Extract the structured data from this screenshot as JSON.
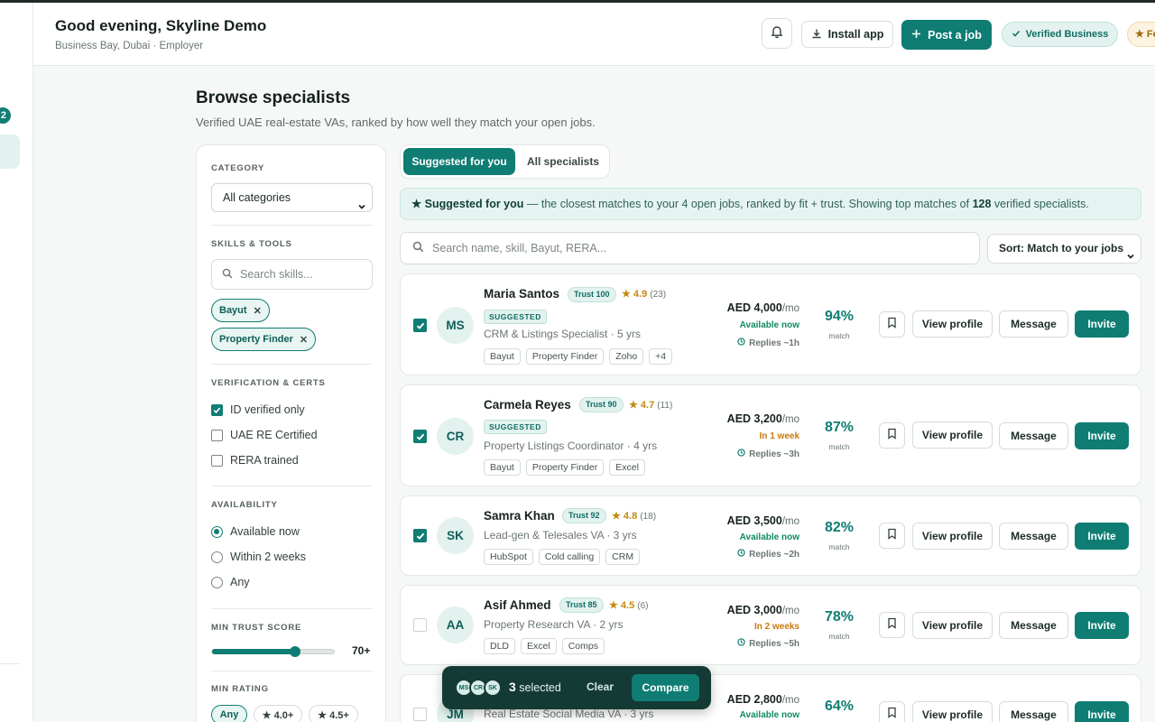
{
  "header": {
    "greeting": "Good evening, Skyline Demo",
    "location": "Business Bay, Dubai · Employer",
    "install_label": "Install app",
    "post_job_label": "Post a job",
    "verified_label": "Verified Business",
    "f_pill_label": "★ Fe"
  },
  "sidebar": {
    "badge": "2"
  },
  "page": {
    "title": "Browse specialists",
    "subtitle": "Verified UAE real-estate VAs, ranked by how well they match your open jobs."
  },
  "filters": {
    "category_label": "CATEGORY",
    "category_value": "All categories",
    "skills_label": "SKILLS & TOOLS",
    "skills_placeholder": "Search skills...",
    "chips": [
      "Bayut",
      "Property Finder"
    ],
    "verification_label": "VERIFICATION & CERTS",
    "verification": [
      {
        "label": "ID verified only",
        "checked": true
      },
      {
        "label": "UAE RE Certified",
        "checked": false
      },
      {
        "label": "RERA trained",
        "checked": false
      }
    ],
    "availability_label": "AVAILABILITY",
    "availability": [
      {
        "label": "Available now",
        "selected": true
      },
      {
        "label": "Within 2 weeks",
        "selected": false
      },
      {
        "label": "Any",
        "selected": false
      }
    ],
    "min_trust_label": "MIN TRUST SCORE",
    "min_trust_value": "70+",
    "min_trust_fraction": 0.68,
    "min_rating_label": "MIN RATING",
    "rating_options": [
      {
        "label": "Any",
        "selected": true
      },
      {
        "label": "★ 4.0+",
        "selected": false
      },
      {
        "label": "★ 4.5+",
        "selected": false
      }
    ]
  },
  "tabs": {
    "suggested": "Suggested for you",
    "all": "All specialists"
  },
  "banner": {
    "lead": "★ Suggested for you",
    "text_1": " — the closest matches to your 4 open jobs, ranked by fit + trust. Showing top matches of ",
    "count": "128",
    "text_2": " verified specialists."
  },
  "search": {
    "placeholder": "Search name, skill, Bayut, RERA..."
  },
  "sort": {
    "label": "Sort: Match to your jobs"
  },
  "actions": {
    "view_profile": "View profile",
    "message": "Message",
    "invite": "Invite",
    "match_label": "match",
    "per_month": "/mo"
  },
  "specialists": [
    {
      "initials": "MS",
      "name": "Maria Santos",
      "trust": "Trust 100",
      "rating": "★ 4.9",
      "reviews": "(23)",
      "suggested": "SUGGESTED",
      "role": "CRM & Listings Specialist · 5 yrs",
      "tags": [
        "Bayut",
        "Property Finder",
        "Zoho",
        "+4"
      ],
      "price": "AED 4,000",
      "availability": "Available now",
      "availability_color": "#0f8a5f",
      "replies": "Replies ~1h",
      "match": "94%",
      "checked": true
    },
    {
      "initials": "CR",
      "name": "Carmela Reyes",
      "trust": "Trust 90",
      "rating": "★ 4.7",
      "reviews": "(11)",
      "suggested": "SUGGESTED",
      "role": "Property Listings Coordinator · 4 yrs",
      "tags": [
        "Bayut",
        "Property Finder",
        "Excel"
      ],
      "price": "AED 3,200",
      "availability": "In 1 week",
      "availability_color": "#c77a0a",
      "replies": "Replies ~3h",
      "match": "87%",
      "checked": true
    },
    {
      "initials": "SK",
      "name": "Samra Khan",
      "trust": "Trust 92",
      "rating": "★ 4.8",
      "reviews": "(18)",
      "suggested": "",
      "role": "Lead-gen & Telesales VA · 3 yrs",
      "tags": [
        "HubSpot",
        "Cold calling",
        "CRM"
      ],
      "price": "AED 3,500",
      "availability": "Available now",
      "availability_color": "#0f8a5f",
      "replies": "Replies ~2h",
      "match": "82%",
      "checked": true
    },
    {
      "initials": "AA",
      "name": "Asif Ahmed",
      "trust": "Trust 85",
      "rating": "★ 4.5",
      "reviews": "(6)",
      "suggested": "",
      "role": "Property Research VA · 2 yrs",
      "tags": [
        "DLD",
        "Excel",
        "Comps"
      ],
      "price": "AED 3,000",
      "availability": "In 2 weeks",
      "availability_color": "#c77a0a",
      "replies": "Replies ~5h",
      "match": "78%",
      "checked": false
    },
    {
      "initials": "JM",
      "name": "",
      "trust": "",
      "rating": "",
      "reviews": "",
      "suggested": "",
      "role": "Real Estate Social Media VA · 3 yrs",
      "tags": [],
      "price": "AED 2,800",
      "availability": "Available now",
      "availability_color": "#0f8a5f",
      "replies": "",
      "match": "64%",
      "checked": false
    }
  ],
  "compare_bar": {
    "avatars": [
      "MS",
      "CR",
      "SK"
    ],
    "count": "3",
    "selected_label": " selected",
    "clear_label": "Clear",
    "compare_label": "Compare"
  }
}
